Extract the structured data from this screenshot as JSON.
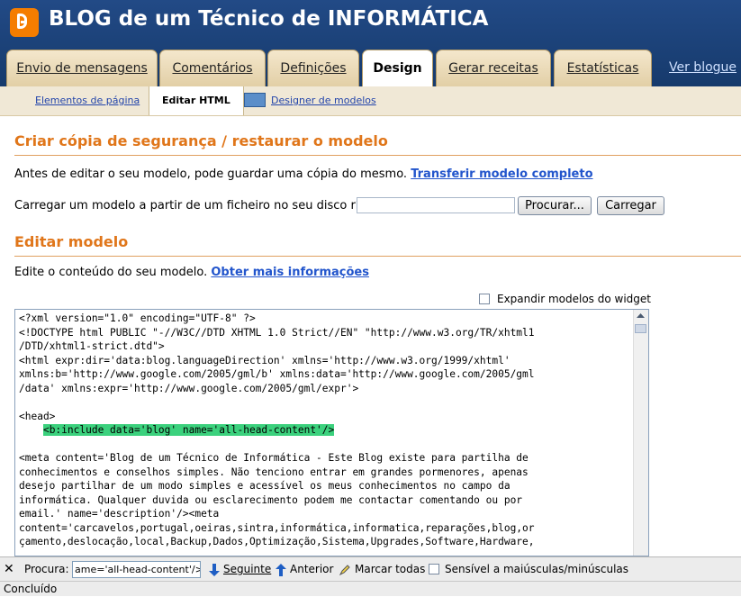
{
  "header": {
    "title": "BLOG de um Técnico de INFORMÁTICA",
    "logo": "blogger-logo-icon"
  },
  "tabs": [
    {
      "label": "Envio de mensagens",
      "active": false
    },
    {
      "label": "Comentários",
      "active": false
    },
    {
      "label": "Definições",
      "active": false
    },
    {
      "label": "Design",
      "active": true
    },
    {
      "label": "Gerar receitas",
      "active": false
    },
    {
      "label": "Estatísticas",
      "active": false
    }
  ],
  "view_blog": "Ver blogue",
  "subnav": {
    "page_elements": "Elementos de página",
    "edit_html": "Editar HTML",
    "template_designer": "Designer de modelos"
  },
  "backup": {
    "title": "Criar cópia de segurança / restaurar o modelo",
    "intro": "Antes de editar o seu modelo, pode guardar uma cópia do mesmo.",
    "download_link": "Transferir modelo completo",
    "upload_label": "Carregar um modelo a partir de um ficheiro no seu disco rígido:",
    "browse_button": "Procurar...",
    "upload_button": "Carregar"
  },
  "edit": {
    "title": "Editar modelo",
    "intro": "Edite o conteúdo do seu modelo.",
    "more_info_link": "Obter mais informações",
    "expand_widgets_label": "Expandir modelos do widget"
  },
  "code_lines": [
    "<?xml version=\"1.0\" encoding=\"UTF-8\" ?>",
    "<!DOCTYPE html PUBLIC \"-//W3C//DTD XHTML 1.0 Strict//EN\" \"http://www.w3.org/TR/xhtml1",
    "/DTD/xhtml1-strict.dtd\">",
    "<html expr:dir='data:blog.languageDirection' xmlns='http://www.w3.org/1999/xhtml'",
    "xmlns:b='http://www.google.com/2005/gml/b' xmlns:data='http://www.google.com/2005/gml",
    "/data' xmlns:expr='http://www.google.com/2005/gml/expr'>",
    "",
    "<head>",
    "    <b:include data='blog' name='all-head-content'/>",
    "",
    "<meta content='Blog de um Técnico de Informática - Este Blog existe para partilha de",
    "conhecimentos e conselhos simples. Não tenciono entrar em grandes pormenores, apenas",
    "desejo partilhar de um modo simples e acessível os meus conhecimentos no campo da",
    "informática. Qualquer duvida ou esclarecimento podem me contactar comentando ou por",
    "email.' name='description'/><meta",
    "content='carcavelos,portugal,oeiras,sintra,informática,informatica,reparações,blog,or",
    "çamento,deslocação,local,Backup,Dados,Optimização,Sistema,Upgrades,Software,Hardware,"
  ],
  "highlighted_line": 8,
  "find_bar": {
    "label": "Procura:",
    "value": "ame='all-head-content'/>",
    "next": "Seguinte",
    "previous": "Anterior",
    "highlight_all": "Marcar todas",
    "match_case": "Sensível a maiúsculas/minúsculas"
  },
  "status": "Concluído",
  "colors": {
    "header_bg": "#1a3a6e",
    "accent": "#e0761a",
    "link": "#2255cc",
    "highlight": "#3bd17d"
  }
}
